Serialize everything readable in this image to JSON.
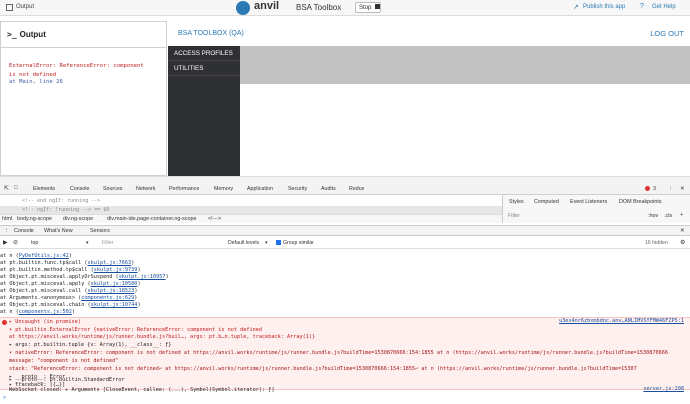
{
  "app_bar": {
    "output_tab": "Output",
    "brand": "anvil",
    "title": "BSA Toolbox",
    "stop_label": "Stop",
    "publish_label": "Publish this app",
    "help_label": "Get Help"
  },
  "output_panel": {
    "title": "Output",
    "error_line1": "ExternalError: ReferenceError: component",
    "error_line2": "is not defined",
    "location": "at Main, line 26"
  },
  "app": {
    "title": "BSA TOOLBOX (QA)",
    "logout": "LOG OUT",
    "nav": [
      "ACCESS PROFILES",
      "UTILITIES"
    ]
  },
  "devtools": {
    "tabs": [
      "Elements",
      "Console",
      "Sources",
      "Network",
      "Performance",
      "Memory",
      "Application",
      "Security",
      "Audits",
      "Redux"
    ],
    "error_count": "3",
    "elements_lines": [
      "<!-- end ngIf: running -->",
      "<!-- ngIf: !running --> == $0"
    ],
    "breadcrumbs": [
      "html",
      "body.ng-scope",
      "div.ng-scope",
      "div.main-ide.page-container.ng-scope",
      "<!--->"
    ],
    "styles_tabs": [
      "Styles",
      "Computed",
      "Event Listeners",
      "DOM Breakpoints"
    ],
    "styles_filter": "Filter",
    "styles_hov": ":hov",
    "styles_cls": ".cls",
    "drawer_tabs": [
      "Console",
      "What's New",
      "Sensors"
    ],
    "context": "top",
    "filter_placeholder": "Filter",
    "levels": "Default levels",
    "group_similar": "Group similar",
    "hidden_count": "16 hidden"
  },
  "console_lines": [
    {
      "text": "    at n (",
      "link": "PyDefUtils.js:42",
      "tail": ")"
    },
    {
      "text": "    at pt.builtin.func.tp$call (",
      "link": "skulpt.js:7663",
      "tail": ")"
    },
    {
      "text": "    at pt.builtin.method.tp$call (",
      "link": "skulpt.js:9739",
      "tail": ")"
    },
    {
      "text": "    at Object.pt.misceval.applyOrSuspend (",
      "link": "skulpt.js:10957",
      "tail": ")"
    },
    {
      "text": "    at Object.pt.misceval.apply (",
      "link": "skulpt.js:10580",
      "tail": ")"
    },
    {
      "text": "    at Object.pt.misceval.call (",
      "link": "skulpt.js:18523",
      "tail": ")"
    },
    {
      "text": "    at Arguments.<anonymous> (",
      "link": "components.js:629",
      "tail": ")"
    },
    {
      "text": "    at Object.pt.misceval.chain (",
      "link": "skulpt.js:10744",
      "tail": ")"
    },
    {
      "text": "    at n (",
      "link": "components.js:502",
      "tail": ")"
    }
  ],
  "error_block": {
    "line1": "▸ Uncaught (in promise)",
    "line1_src": "u3es4nr6zbxmbdnc.anv…ANLIMVSYFMW46FZP5:1",
    "line2": "▾ pt.builtin.ExternalError {nativeError: ReferenceError: component is not defined",
    "line3": "    at https://anvil.works/runtime/js/runner.bundle.js?buil…, args: pt.b…n.tuple, traceback: Array(1)}",
    "line4": "  ▸ args: pt.builtin.tuple {v: Array(1), __class__: ƒ}",
    "line5": "  ▾ nativeError: ReferenceError: component is not defined at https://anvil.works/runtime/js/runner.bundle.js?buildTime=1530870666:154:1855 at n (https://anvil.works/runtime/js/runner.bundle.js?buildTime=1530870666",
    "line6": "      message: \"component is not defined\"",
    "line7": "      stack: \"ReferenceError: component is not defined⏎    at https://anvil.works/runtime/js/runner.bundle.js?buildTime=1530870666:154:1855⏎    at n (https://anvil.works/runtime/js/runner.bundle.js?buildTime=15307",
    "line8": "    ▸ __proto__: Error",
    "line9": "  ▸ traceback: [{…}]",
    "line10": "  ▸ __proto__: pt.builtin.StandardError"
  },
  "websocket_line": "WebSocket closed: ▸ Arguments [CloseEvent, callee: (...), Symbol(Symbol.iterator): ƒ]",
  "websocket_src": "server.js:208",
  "colors": {
    "accent": "#2c7ab5",
    "error_text": "#c01a1a",
    "nav_bg": "#2f3033"
  }
}
